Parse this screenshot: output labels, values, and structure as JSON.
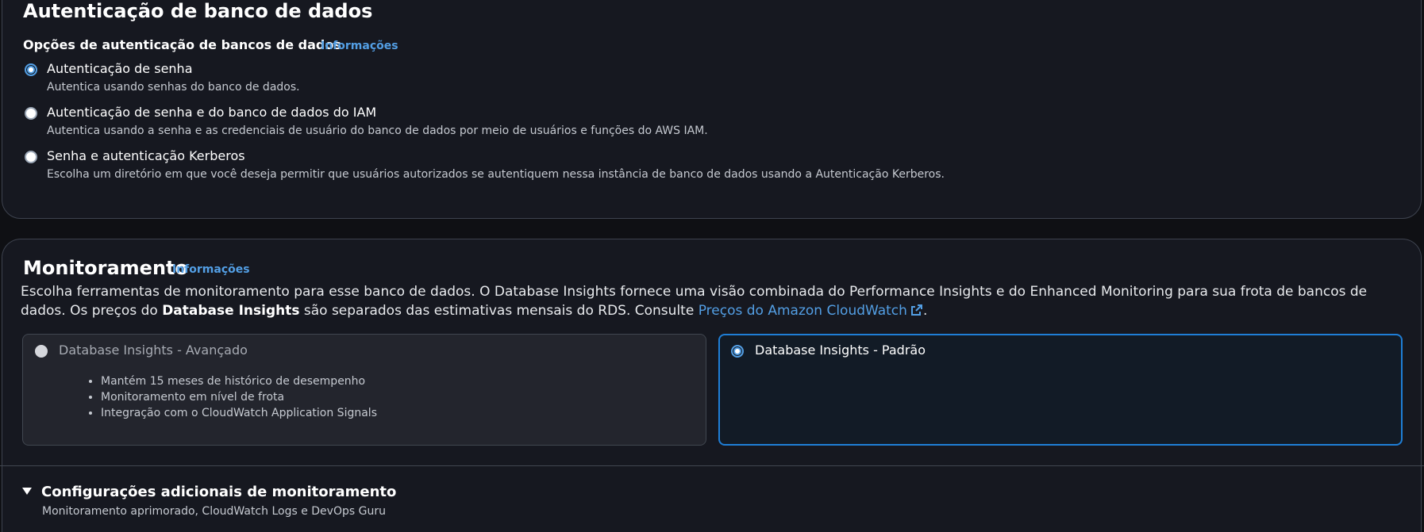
{
  "auth_section": {
    "title": "Autenticação de banco de dados",
    "options_heading": "Opções de autenticação de bancos de dados",
    "info_link": "Informações",
    "options": [
      {
        "label": "Autenticação de senha",
        "description": "Autentica usando senhas do banco de dados.",
        "selected": true
      },
      {
        "label": "Autenticação de senha e do banco de dados do IAM",
        "description": "Autentica usando a senha e as credenciais de usuário do banco de dados por meio de usuários e funções do AWS IAM.",
        "selected": false
      },
      {
        "label": "Senha e autenticação Kerberos",
        "description": "Escolha um diretório em que você deseja permitir que usuários autorizados se autentiquem nessa instância de banco de dados usando a Autenticação Kerberos.",
        "selected": false
      }
    ]
  },
  "monitoring": {
    "title": "Monitoramento",
    "info_link": "Informações",
    "description_part1": "Escolha ferramentas de monitoramento para esse banco de dados. O Database Insights fornece uma visão combinada do Performance Insights e do Enhanced Monitoring para sua frota de bancos de dados. Os preços do ",
    "description_bold": "Database Insights",
    "description_part2": " são separados das estimativas mensais do RDS. Consulte ",
    "description_link": "Preços do Amazon CloudWatch",
    "description_end": ".",
    "tiles": [
      {
        "title": "Database Insights - Avançado",
        "selected": false,
        "disabled": true,
        "bullets": [
          "Mantém 15 meses de histórico de desempenho",
          "Monitoramento em nível de frota",
          "Integração com o CloudWatch Application Signals"
        ]
      },
      {
        "title": "Database Insights - Padrão",
        "selected": true,
        "disabled": false,
        "bullets": []
      }
    ],
    "additional": {
      "title": "Configurações adicionais de monitoramento",
      "subtitle": "Monitoramento aprimorado, CloudWatch Logs e DevOps Guru",
      "expanded": true
    }
  },
  "colors": {
    "background": "#0f1014",
    "card": "#161820",
    "accent": "#539fe5",
    "selected_border": "#1f7ed6"
  },
  "icons": [
    "external-link-icon",
    "caret-down-icon"
  ]
}
